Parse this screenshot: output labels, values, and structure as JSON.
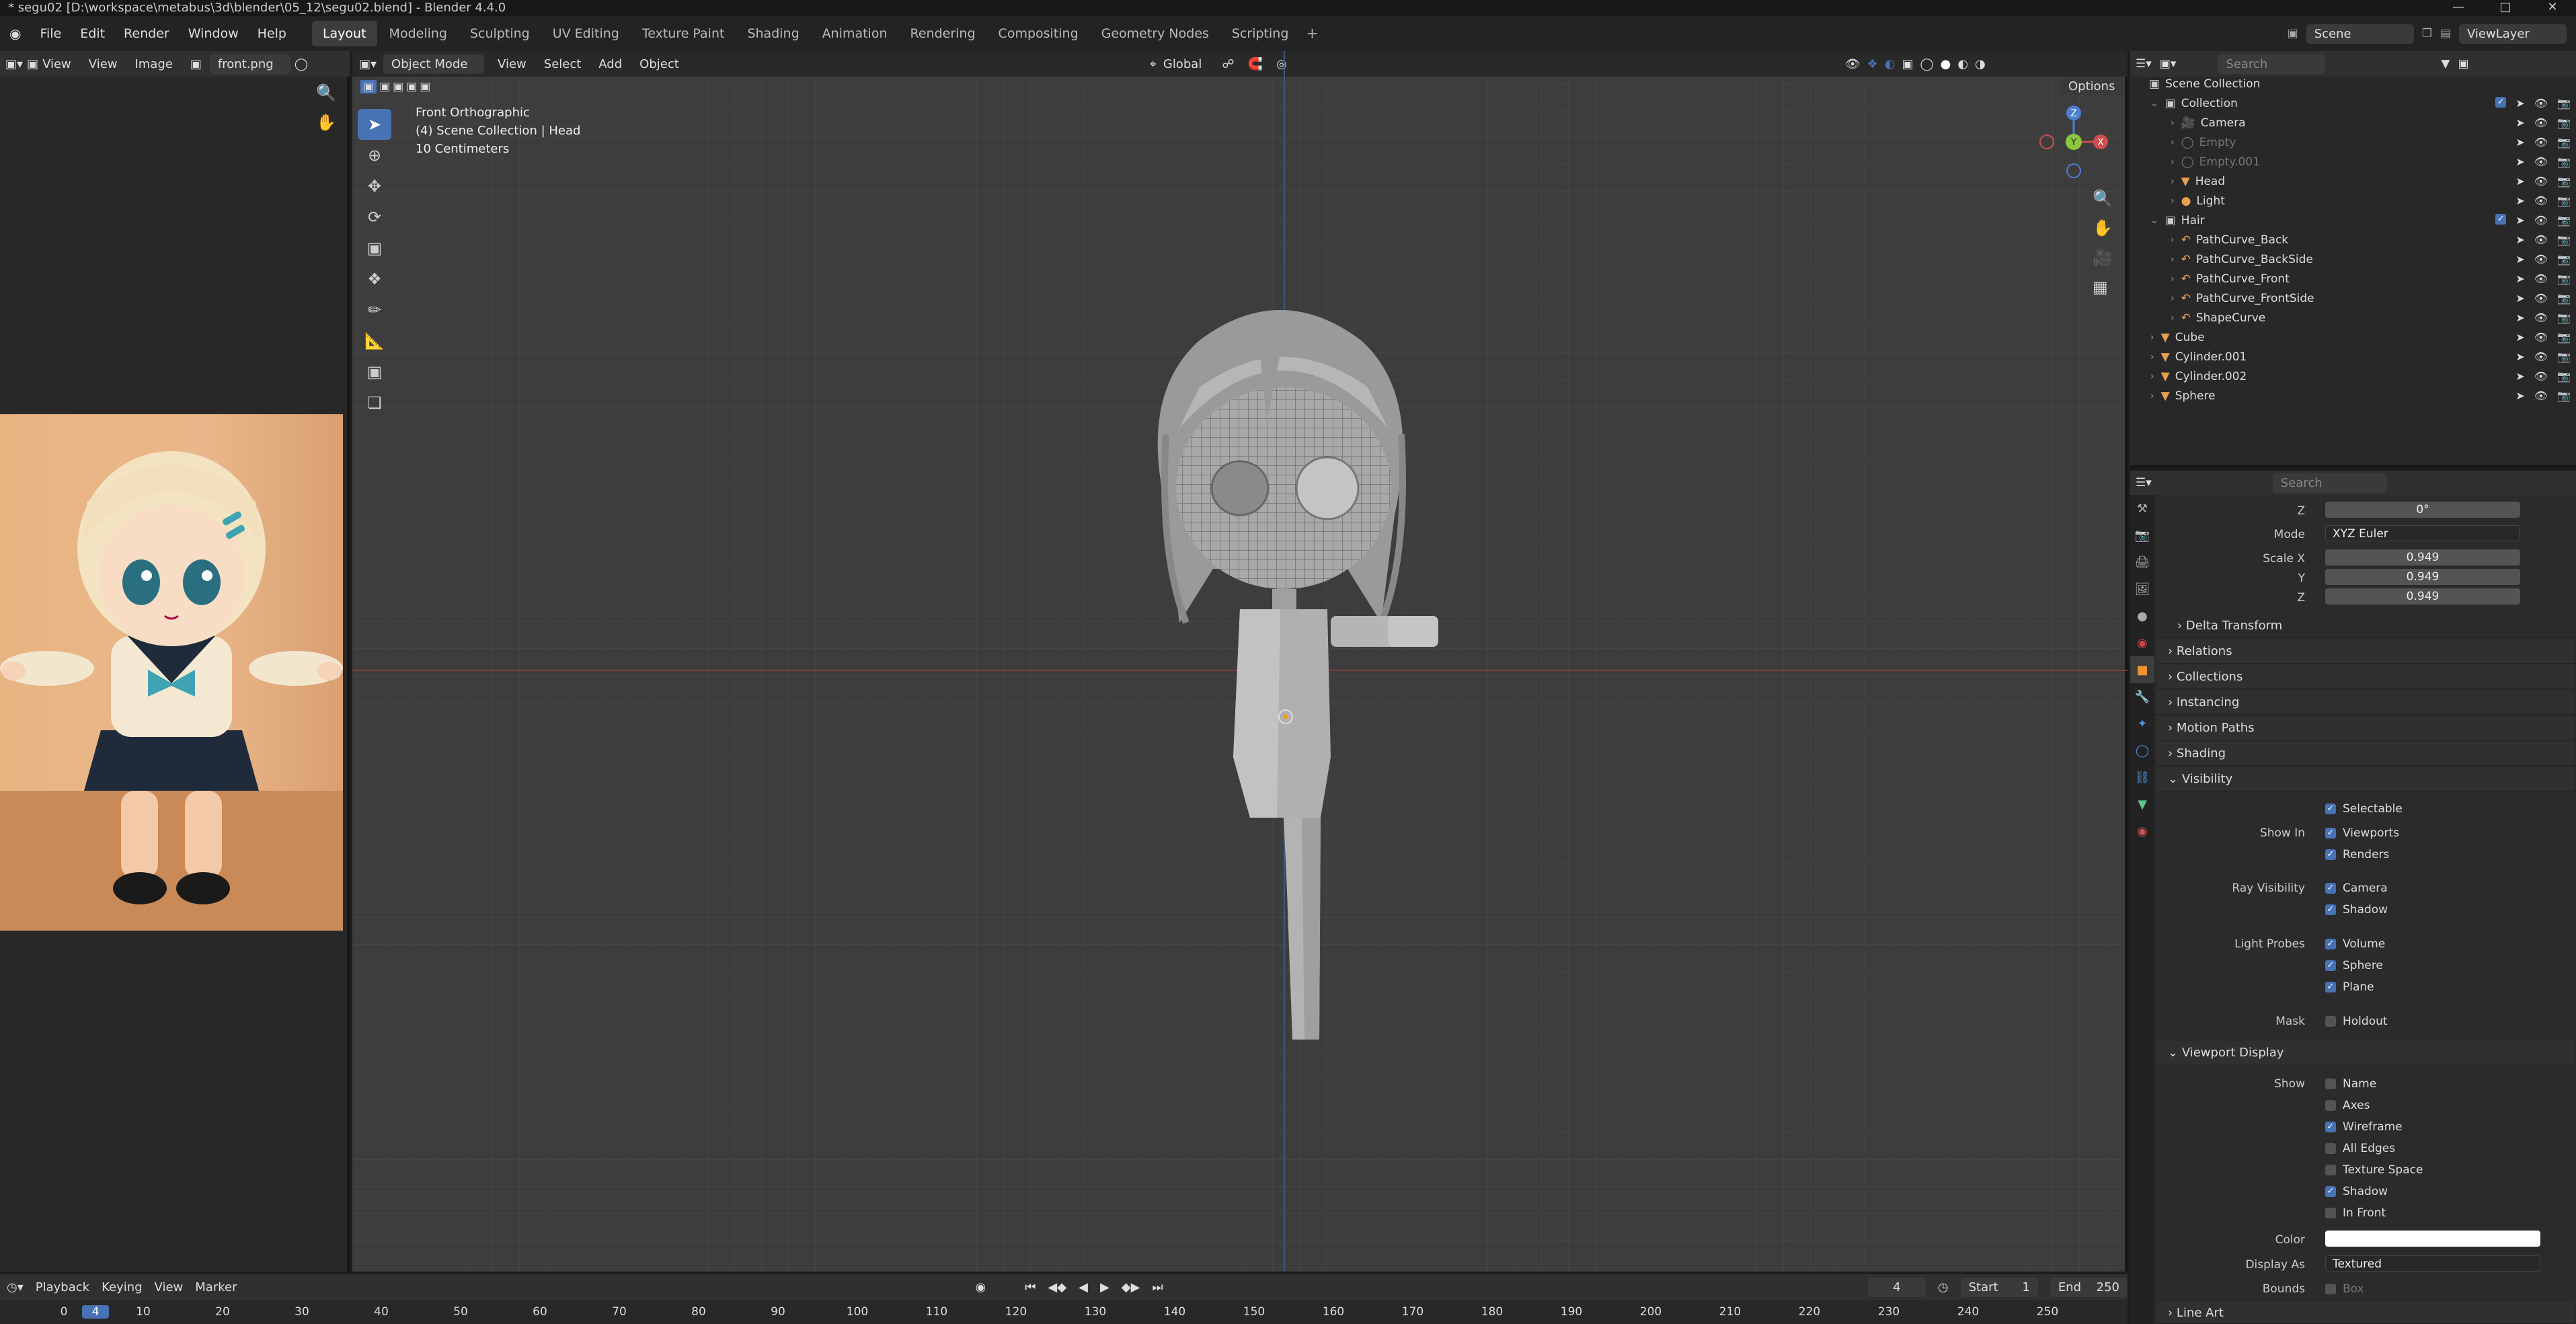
{
  "window": {
    "title": "* segu02 [D:\\workspace\\metabus\\3d\\blender\\05_12\\segu02.blend] - Blender 4.4.0"
  },
  "menubar": {
    "file": "File",
    "edit": "Edit",
    "render": "Render",
    "window": "Window",
    "help": "Help"
  },
  "workspaces": [
    "Layout",
    "Modeling",
    "Sculpting",
    "UV Editing",
    "Texture Paint",
    "Shading",
    "Animation",
    "Rendering",
    "Compositing",
    "Geometry Nodes",
    "Scripting"
  ],
  "scene": {
    "scene_name": "Scene",
    "view_layer": "ViewLayer"
  },
  "image_editor": {
    "view": "View",
    "view2": "View",
    "image": "Image",
    "filename": "front.png"
  },
  "viewport": {
    "mode": "Object Mode",
    "view": "View",
    "select": "Select",
    "add": "Add",
    "object": "Object",
    "orientation": "Global",
    "options": "Options",
    "overlay_line1": "Front Orthographic",
    "overlay_line2": "(4) Scene Collection | Head",
    "overlay_line3": "10 Centimeters",
    "gizmo": {
      "z": "Z",
      "y": "Y",
      "x": "X"
    }
  },
  "outliner": {
    "search_placeholder": "Search",
    "root": "Scene Collection",
    "items": [
      {
        "label": "Collection",
        "indent": 1,
        "type": "collection"
      },
      {
        "label": "Camera",
        "indent": 2,
        "type": "camera"
      },
      {
        "label": "Empty",
        "indent": 2,
        "type": "empty",
        "dim": true
      },
      {
        "label": "Empty.001",
        "indent": 2,
        "type": "empty",
        "dim": true
      },
      {
        "label": "Head",
        "indent": 2,
        "type": "mesh"
      },
      {
        "label": "Light",
        "indent": 2,
        "type": "light"
      },
      {
        "label": "Hair",
        "indent": 1,
        "type": "collection"
      },
      {
        "label": "PathCurve_Back",
        "indent": 2,
        "type": "curve"
      },
      {
        "label": "PathCurve_BackSide",
        "indent": 2,
        "type": "curve"
      },
      {
        "label": "PathCurve_Front",
        "indent": 2,
        "type": "curve"
      },
      {
        "label": "PathCurve_FrontSide",
        "indent": 2,
        "type": "curve"
      },
      {
        "label": "ShapeCurve",
        "indent": 2,
        "type": "curve"
      },
      {
        "label": "Cube",
        "indent": 1,
        "type": "mesh"
      },
      {
        "label": "Cylinder.001",
        "indent": 1,
        "type": "mesh"
      },
      {
        "label": "Cylinder.002",
        "indent": 1,
        "type": "mesh"
      },
      {
        "label": "Sphere",
        "indent": 1,
        "type": "mesh"
      }
    ]
  },
  "properties": {
    "search_placeholder": "Search",
    "rot_z_label": "Z",
    "rot_z": "0°",
    "mode_label": "Mode",
    "mode": "XYZ Euler",
    "scale_x_label": "Scale X",
    "scale_x": "0.949",
    "scale_y_label": "Y",
    "scale_y": "0.949",
    "scale_z_label": "Z",
    "scale_z": "0.949",
    "delta_transform": "Delta Transform",
    "panels": {
      "relations": "Relations",
      "collections": "Collections",
      "instancing": "Instancing",
      "motion_paths": "Motion Paths",
      "shading": "Shading",
      "visibility": "Visibility",
      "viewport_display": "Viewport Display",
      "line_art": "Line Art"
    },
    "visibility": {
      "selectable": "Selectable",
      "show_in": "Show In",
      "viewports": "Viewports",
      "renders": "Renders",
      "ray_visibility": "Ray Visibility",
      "camera": "Camera",
      "shadow": "Shadow",
      "light_probes": "Light Probes",
      "volume": "Volume",
      "sphere": "Sphere",
      "plane": "Plane",
      "mask": "Mask",
      "holdout": "Holdout"
    },
    "viewport_display": {
      "show": "Show",
      "name": "Name",
      "axes": "Axes",
      "wireframe": "Wireframe",
      "all_edges": "All Edges",
      "texture_space": "Texture Space",
      "shadow": "Shadow",
      "in_front": "In Front",
      "color_label": "Color",
      "color": "#ffffff",
      "display_as_label": "Display As",
      "display_as": "Textured",
      "bounds_label": "Bounds",
      "bounds": "Box"
    }
  },
  "timeline": {
    "playback": "Playback",
    "keying": "Keying",
    "view": "View",
    "marker": "Marker",
    "current_frame": "4",
    "start_label": "Start",
    "start": "1",
    "end_label": "End",
    "end": "250",
    "ticks": [
      "0",
      "4",
      "10",
      "20",
      "30",
      "40",
      "50",
      "60",
      "70",
      "80",
      "90",
      "100",
      "110",
      "120",
      "130",
      "140",
      "150",
      "160",
      "170",
      "180",
      "190",
      "200",
      "210",
      "220",
      "230",
      "240",
      "250"
    ]
  },
  "colors": {
    "accent": "#4772b3",
    "header": "#303030",
    "panel_bg": "#282828"
  }
}
